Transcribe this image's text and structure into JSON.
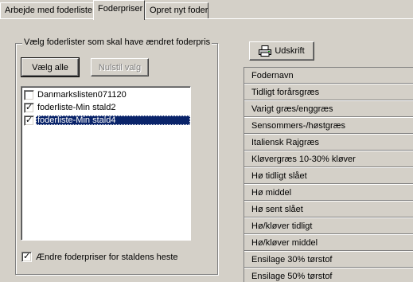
{
  "tabs": [
    {
      "label": "Arbejde med foderliste",
      "active": false
    },
    {
      "label": "Foderpriser",
      "active": true
    },
    {
      "label": "Opret nyt foder",
      "active": false
    }
  ],
  "group": {
    "title": "Vælg foderlister som skal have ændret foderpris",
    "select_all_label": "Vælg alle",
    "reset_label": "Nulstil valg",
    "lists": [
      {
        "label": "Danmarkslisten071120",
        "checked": false,
        "selected": false
      },
      {
        "label": "foderliste-Min stald2",
        "checked": true,
        "selected": false
      },
      {
        "label": "foderliste-Min stald4",
        "checked": true,
        "selected": true
      }
    ],
    "change_prices_label": "Ændre foderpriser for staldens heste",
    "change_prices_checked": true
  },
  "print": {
    "label": "Udskrift",
    "icon": "printer-icon"
  },
  "feed_table": {
    "header": "Fodernavn",
    "rows": [
      "Tidligt forårsgræs",
      "Varigt græs/enggræs",
      "Sensommers-/høstgræs",
      "Italiensk Rajgræs",
      "Kløvergræs 10-30% kløver",
      "Hø tidligt slået",
      "Hø middel",
      "Hø sent slået",
      "Hø/kløver tidligt",
      "Hø/kløver middel",
      "Ensilage 30% tørstof",
      "Ensilage 50% tørstof"
    ]
  },
  "colors": {
    "face": "#d4d0c8",
    "selection": "#0a246a",
    "disabled_text": "#808080"
  }
}
